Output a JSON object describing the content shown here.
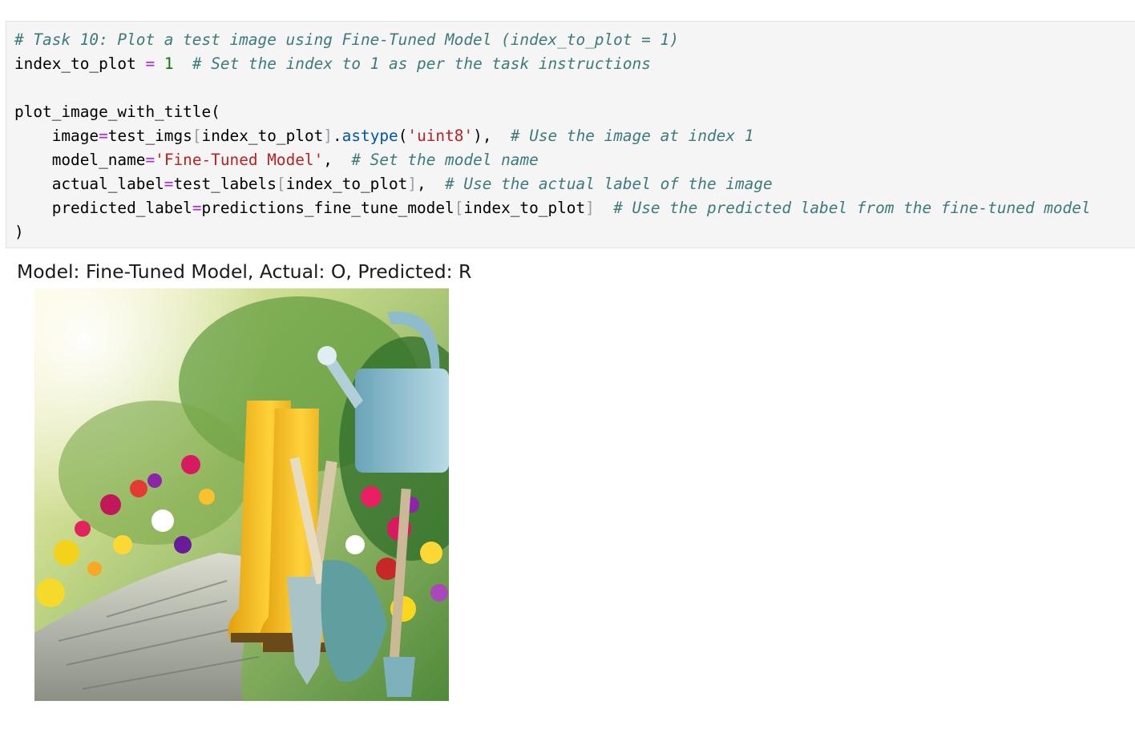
{
  "code_cell": {
    "lines": [
      [
        {
          "t": "# Task 10: Plot a test image using Fine-Tuned Model (index_to_plot = 1)",
          "c": "c"
        }
      ],
      [
        {
          "t": "index_to_plot ",
          "c": ""
        },
        {
          "t": "=",
          "c": "op"
        },
        {
          "t": " ",
          "c": ""
        },
        {
          "t": "1",
          "c": "num"
        },
        {
          "t": "  ",
          "c": ""
        },
        {
          "t": "# Set the index to 1 as per the task instructions",
          "c": "c"
        }
      ],
      [],
      [
        {
          "t": "plot_image_with_title(",
          "c": ""
        }
      ],
      [
        {
          "t": "    image",
          "c": ""
        },
        {
          "t": "=",
          "c": "op"
        },
        {
          "t": "test_imgs",
          "c": ""
        },
        {
          "t": "[",
          "c": "br"
        },
        {
          "t": "index_to_plot",
          "c": ""
        },
        {
          "t": "]",
          "c": "br"
        },
        {
          "t": ".",
          "c": ""
        },
        {
          "t": "astype",
          "c": "meth"
        },
        {
          "t": "(",
          "c": ""
        },
        {
          "t": "'uint8'",
          "c": "str"
        },
        {
          "t": "),  ",
          "c": ""
        },
        {
          "t": "# Use the image at index 1",
          "c": "c"
        }
      ],
      [
        {
          "t": "    model_name",
          "c": ""
        },
        {
          "t": "=",
          "c": "op"
        },
        {
          "t": "'Fine-Tuned Model'",
          "c": "str"
        },
        {
          "t": ",  ",
          "c": ""
        },
        {
          "t": "# Set the model name",
          "c": "c"
        }
      ],
      [
        {
          "t": "    actual_label",
          "c": ""
        },
        {
          "t": "=",
          "c": "op"
        },
        {
          "t": "test_labels",
          "c": ""
        },
        {
          "t": "[",
          "c": "br"
        },
        {
          "t": "index_to_plot",
          "c": ""
        },
        {
          "t": "]",
          "c": "br"
        },
        {
          "t": ",  ",
          "c": ""
        },
        {
          "t": "# Use the actual label of the image",
          "c": "c"
        }
      ],
      [
        {
          "t": "    predicted_label",
          "c": ""
        },
        {
          "t": "=",
          "c": "op"
        },
        {
          "t": "predictions_fine_tune_model",
          "c": ""
        },
        {
          "t": "[",
          "c": "br"
        },
        {
          "t": "index_to_plot",
          "c": ""
        },
        {
          "t": "]",
          "c": "br"
        },
        {
          "t": "  ",
          "c": ""
        },
        {
          "t": "# Use the predicted label from the fine-tuned model",
          "c": "c"
        }
      ],
      [
        {
          "t": ")",
          "c": ""
        }
      ]
    ]
  },
  "output": {
    "plot_title": "Model: Fine-Tuned Model, Actual: O, Predicted: R",
    "image_subject": "garden-tools-boots-flowers-photo"
  },
  "colors": {
    "cell_background": "#f5f5f5",
    "comment": "#3d7b7b",
    "operator": "#aa22ff",
    "number": "#008000",
    "string": "#ba2121",
    "method": "#0055aa"
  }
}
